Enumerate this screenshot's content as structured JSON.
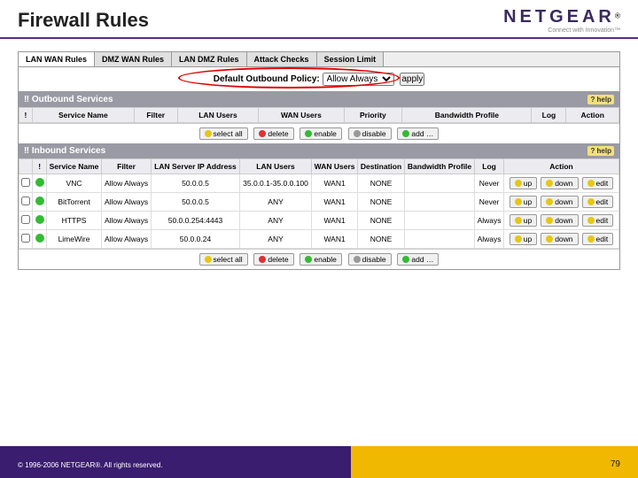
{
  "header": {
    "title": "Firewall Rules",
    "logo": "NETGEAR",
    "logo_sub": "Connect with Innovation™"
  },
  "tabs": [
    "LAN WAN Rules",
    "DMZ WAN Rules",
    "LAN DMZ Rules",
    "Attack Checks",
    "Session Limit"
  ],
  "policy": {
    "label": "Default Outbound Policy:",
    "value": "Allow Always",
    "apply": "apply"
  },
  "help_label": "? help",
  "sections": {
    "outbound": {
      "title": "Outbound Services",
      "cols": [
        "!",
        "Service Name",
        "Filter",
        "LAN Users",
        "WAN Users",
        "Priority",
        "Bandwidth Profile",
        "Log",
        "Action"
      ]
    },
    "inbound": {
      "title": "Inbound Services",
      "cols": [
        "",
        "!",
        "Service Name",
        "Filter",
        "LAN Server IP Address",
        "LAN Users",
        "WAN Users",
        "Destination",
        "Bandwidth Profile",
        "Log",
        "Action"
      ],
      "rows": [
        {
          "svc": "VNC",
          "filter": "Allow Always",
          "ip": "50.0.0.5",
          "lan": "35.0.0.1-35.0.0.100",
          "wan": "WAN1",
          "dest": "NONE",
          "log": "Never"
        },
        {
          "svc": "BitTorrent",
          "filter": "Allow Always",
          "ip": "50.0.0.5",
          "lan": "ANY",
          "wan": "WAN1",
          "dest": "NONE",
          "log": "Never"
        },
        {
          "svc": "HTTPS",
          "filter": "Allow Always",
          "ip": "50.0.0.254:4443",
          "lan": "ANY",
          "wan": "WAN1",
          "dest": "NONE",
          "log": "Always"
        },
        {
          "svc": "LimeWire",
          "filter": "Allow Always",
          "ip": "50.0.0.24",
          "lan": "ANY",
          "wan": "WAN1",
          "dest": "NONE",
          "log": "Always"
        }
      ]
    }
  },
  "buttons": {
    "selectall": "select all",
    "delete": "delete",
    "enable": "enable",
    "disable": "disable",
    "add": "add …",
    "up": "up",
    "down": "down",
    "edit": "edit"
  },
  "footer": {
    "copyright": "© 1996-2006 NETGEAR®. All rights reserved.",
    "page": "79"
  }
}
